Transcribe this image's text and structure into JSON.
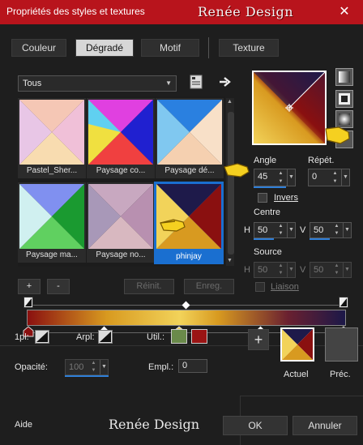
{
  "window": {
    "title": "Propriétés des styles et textures",
    "brand": "Renée Design",
    "close_glyph": "✕"
  },
  "tabs": [
    {
      "label": "Couleur",
      "active": false
    },
    {
      "label": "Dégradé",
      "active": true
    },
    {
      "label": "Motif",
      "active": false
    },
    {
      "label": "Texture",
      "active": false
    }
  ],
  "library": {
    "category": "Tous",
    "thumbnails": [
      {
        "label": "Pastel_Sher...",
        "selected": false
      },
      {
        "label": "Paysage co...",
        "selected": false
      },
      {
        "label": "Paysage dé...",
        "selected": false
      },
      {
        "label": "Paysage ma...",
        "selected": false
      },
      {
        "label": "Paysage no...",
        "selected": false
      },
      {
        "label": "phinjay",
        "selected": true
      }
    ],
    "add_label": "+",
    "remove_label": "-",
    "reset_label": "Réinit.",
    "save_label": "Enreg."
  },
  "settings": {
    "angle_label": "Angle",
    "angle_value": "45",
    "repeat_label": "Répét.",
    "repeat_value": "0",
    "invert_label": "Invers",
    "center_label": "Centre",
    "center_h_label": "H",
    "center_h": "50",
    "center_v_label": "V",
    "center_v": "50",
    "source_label": "Source",
    "source_h_label": "H",
    "source_h": "50",
    "source_v_label": "V",
    "source_v": "50",
    "link_label": "Liaison"
  },
  "bottom": {
    "opl_label": "1pl:",
    "arpl_label": "Arpl:",
    "util_label": "Util.:",
    "opacity_label": "Opacité:",
    "opacity_value": "100",
    "empl_label": "Empl.:",
    "empl_value": "0",
    "current_label": "Actuel",
    "previous_label": "Préc.",
    "add_glyph": "+"
  },
  "footer": {
    "help_label": "Aide",
    "brand": "Renée Design",
    "ok_label": "OK",
    "cancel_label": "Annuler"
  },
  "colors": {
    "accent": "#b8141c",
    "selection": "#1a6fd0",
    "gradient_stops": [
      "#8a1010",
      "#f2d35a",
      "#1b1848"
    ],
    "util_fg": "#6a8a4a",
    "util_bg": "#9a1414",
    "previous_swatch": "#444444"
  },
  "icons": [
    "close-icon",
    "library-icon",
    "arrow-right-icon",
    "pointer-hand-icon",
    "crosshair-icon"
  ]
}
